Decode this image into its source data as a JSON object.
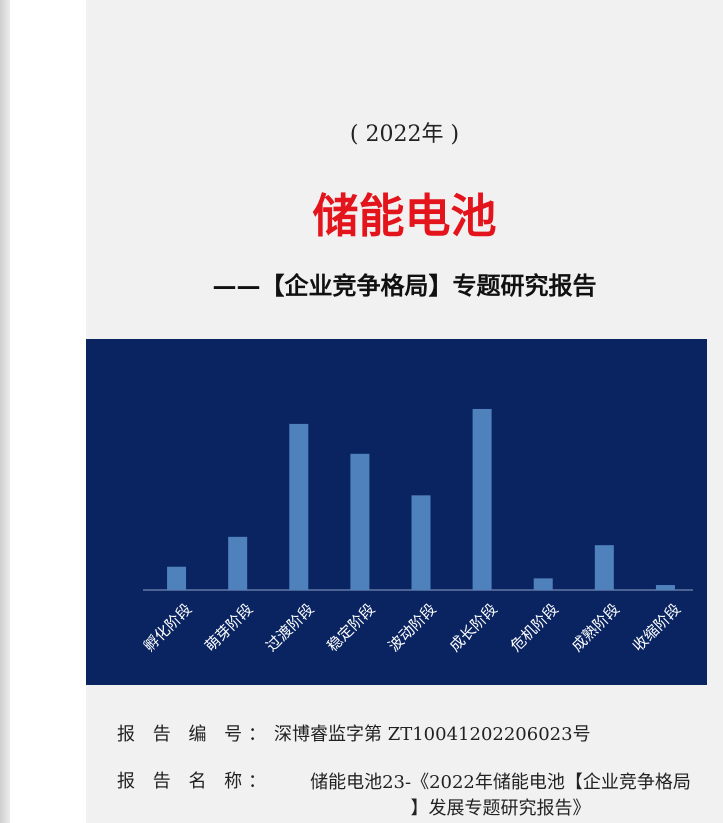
{
  "cover": {
    "year": "( 2022年 )",
    "title": "储能电池",
    "subtitle": "——【企业竞争格局】专题研究报告"
  },
  "chart_data": {
    "type": "bar",
    "categories": [
      "孵化阶段",
      "萌芽阶段",
      "过渡阶段",
      "稳定阶段",
      "波动阶段",
      "成长阶段",
      "危机阶段",
      "成熟阶段",
      "收缩阶段"
    ],
    "values": [
      14,
      32,
      100,
      82,
      57,
      109,
      7,
      27,
      3
    ],
    "ylim": [
      0,
      115
    ],
    "grid": false,
    "legend": "none",
    "bar_color": "#4f81bd",
    "background": "#0a2462",
    "axis_color": "#8ea3c8",
    "label_color": "#ffffff"
  },
  "info": {
    "number_label": "报 告  编 号：",
    "number_value": "深博睿监字第 ZT10041202206023号",
    "name_label": "报 告 名 称：",
    "name_value_line1": "储能电池23-《2022年储能电池【企业竞争格局",
    "name_value_line2": "】发展专题研究报告》"
  }
}
